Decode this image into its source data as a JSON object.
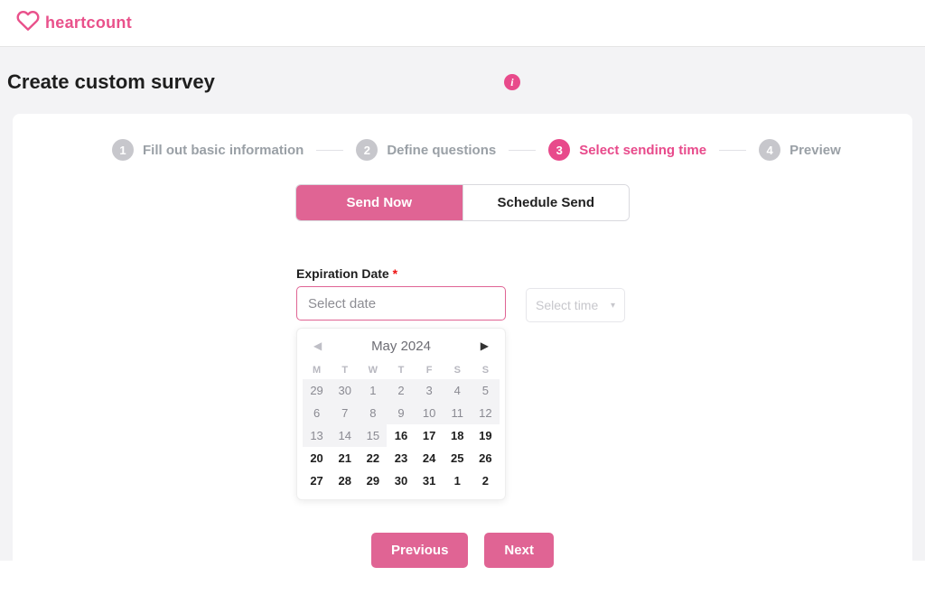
{
  "brand": {
    "name": "heartcount"
  },
  "page": {
    "title": "Create custom survey"
  },
  "stepper": {
    "steps": [
      {
        "num": "1",
        "label": "Fill out basic information"
      },
      {
        "num": "2",
        "label": "Define questions"
      },
      {
        "num": "3",
        "label": "Select sending time"
      },
      {
        "num": "4",
        "label": "Preview"
      }
    ],
    "active_index": 2
  },
  "sendTabs": {
    "now": "Send Now",
    "schedule": "Schedule Send",
    "active": "now"
  },
  "form": {
    "expiration_label": "Expiration Date",
    "required_mark": "*",
    "date_placeholder": "Select date",
    "time_placeholder": "Select time"
  },
  "calendar": {
    "title": "May 2024",
    "dow": [
      "M",
      "T",
      "W",
      "T",
      "F",
      "S",
      "S"
    ],
    "days": [
      {
        "n": "29",
        "dim": true
      },
      {
        "n": "30",
        "dim": true
      },
      {
        "n": "1",
        "dim": true
      },
      {
        "n": "2",
        "dim": true
      },
      {
        "n": "3",
        "dim": true
      },
      {
        "n": "4",
        "dim": true
      },
      {
        "n": "5",
        "dim": true
      },
      {
        "n": "6",
        "dim": true
      },
      {
        "n": "7",
        "dim": true
      },
      {
        "n": "8",
        "dim": true
      },
      {
        "n": "9",
        "dim": true
      },
      {
        "n": "10",
        "dim": true
      },
      {
        "n": "11",
        "dim": true
      },
      {
        "n": "12",
        "dim": true
      },
      {
        "n": "13",
        "dim": true
      },
      {
        "n": "14",
        "dim": true
      },
      {
        "n": "15",
        "dim": true
      },
      {
        "n": "16",
        "dim": false
      },
      {
        "n": "17",
        "dim": false
      },
      {
        "n": "18",
        "dim": false
      },
      {
        "n": "19",
        "dim": false
      },
      {
        "n": "20",
        "dim": false
      },
      {
        "n": "21",
        "dim": false
      },
      {
        "n": "22",
        "dim": false
      },
      {
        "n": "23",
        "dim": false
      },
      {
        "n": "24",
        "dim": false
      },
      {
        "n": "25",
        "dim": false
      },
      {
        "n": "26",
        "dim": false
      },
      {
        "n": "27",
        "dim": false
      },
      {
        "n": "28",
        "dim": false
      },
      {
        "n": "29",
        "dim": false
      },
      {
        "n": "30",
        "dim": false
      },
      {
        "n": "31",
        "dim": false
      },
      {
        "n": "1",
        "dim": false,
        "out": true
      },
      {
        "n": "2",
        "dim": false,
        "out": true
      }
    ]
  },
  "footer": {
    "prev": "Previous",
    "next": "Next"
  }
}
